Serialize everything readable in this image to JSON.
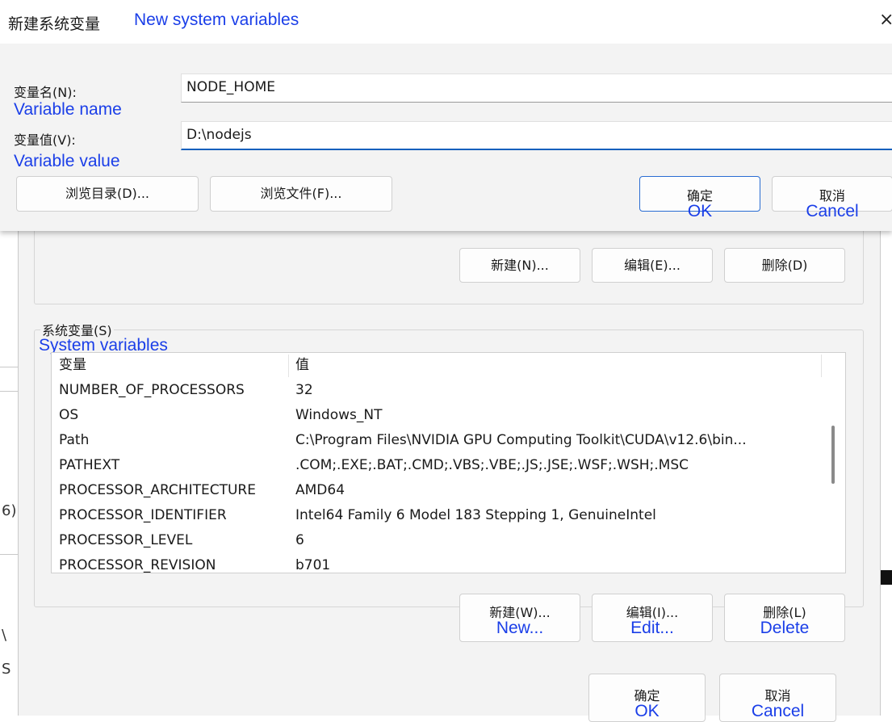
{
  "dialog": {
    "title_cn": "新建系统变量",
    "title_en": "New system variables",
    "close_label": "×",
    "name_label": "变量名(N):",
    "name_label_en": "Variable name",
    "name_value": "NODE_HOME",
    "value_label": "变量值(V):",
    "value_label_en": "Variable value",
    "value_value": "D:\\nodejs",
    "browse_dir_label": "浏览目录(D)...",
    "browse_file_label": "浏览文件(F)...",
    "ok_label": "确定",
    "ok_label_en": "OK",
    "cancel_label": "取消",
    "cancel_label_en": "Cancel"
  },
  "env_window": {
    "left_fragments": [
      "6)",
      "\\",
      "S"
    ],
    "user_buttons": {
      "new_label": "新建(N)...",
      "edit_label": "编辑(E)...",
      "delete_label": "删除(D)"
    },
    "system_group_title": "系统变量(S)",
    "system_group_title_en": "System variables",
    "columns": [
      "变量",
      "值"
    ],
    "rows": [
      {
        "name": "NUMBER_OF_PROCESSORS",
        "value": "32"
      },
      {
        "name": "OS",
        "value": "Windows_NT"
      },
      {
        "name": "Path",
        "value": "C:\\Program Files\\NVIDIA GPU Computing Toolkit\\CUDA\\v12.6\\bin..."
      },
      {
        "name": "PATHEXT",
        "value": ".COM;.EXE;.BAT;.CMD;.VBS;.VBE;.JS;.JSE;.WSF;.WSH;.MSC"
      },
      {
        "name": "PROCESSOR_ARCHITECTURE",
        "value": "AMD64"
      },
      {
        "name": "PROCESSOR_IDENTIFIER",
        "value": "Intel64 Family 6 Model 183 Stepping 1, GenuineIntel"
      },
      {
        "name": "PROCESSOR_LEVEL",
        "value": "6"
      },
      {
        "name": "PROCESSOR_REVISION",
        "value": "b701"
      }
    ],
    "system_buttons": {
      "new_label": "新建(W)...",
      "new_label_en": "New...",
      "edit_label": "编辑(I)...",
      "edit_label_en": "Edit...",
      "delete_label": "删除(L)",
      "delete_label_en": "Delete"
    },
    "ok_label": "确定",
    "ok_label_en": "OK",
    "cancel_label": "取消",
    "cancel_label_en": "Cancel"
  },
  "colors": {
    "annotation": "#1a3ee8",
    "focus_border": "#1560bd",
    "dialog_bg": "#f3f3f3"
  }
}
